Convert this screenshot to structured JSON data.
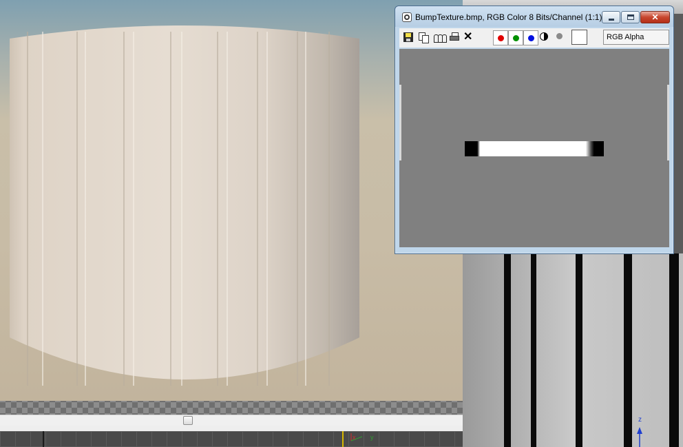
{
  "image_window": {
    "title": "BumpTexture.bmp, RGB Color 8 Bits/Channel (1:1)",
    "close_glyph": "✕",
    "toolbar": {
      "save_icon": "save-icon",
      "copy_icon": "copy-icon",
      "clone_icon": "clone-icon",
      "print_icon": "print-icon",
      "clear_icon": "✕",
      "channels": [
        {
          "name": "red",
          "color": "#e00000"
        },
        {
          "name": "green",
          "color": "#009000"
        },
        {
          "name": "blue",
          "color": "#0010e0"
        }
      ],
      "swatch_color": "#ffffff",
      "channel_select_value": "RGB Alpha"
    },
    "canvas_bg": "#808080"
  },
  "right_viewport": {
    "axis_label": "z"
  },
  "colors": {
    "title_bar": "#bfd6ea",
    "close_button": "#c8462e",
    "cylinder": "#e3d8cb"
  }
}
